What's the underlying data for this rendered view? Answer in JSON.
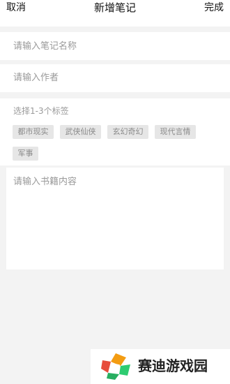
{
  "header": {
    "cancel_label": "取消",
    "title": "新增笔记",
    "done_label": "完成"
  },
  "form": {
    "note_name_placeholder": "请输入笔记名称",
    "author_placeholder": "请输入作者",
    "tags_label": "选择1-3个标签",
    "tags": [
      {
        "label": "都市现实"
      },
      {
        "label": "武侠仙侠"
      },
      {
        "label": "玄幻奇幻"
      },
      {
        "label": "现代言情"
      },
      {
        "label": "军事"
      }
    ],
    "content_placeholder": "请输入书籍内容"
  },
  "watermark": {
    "text": "赛迪游戏园",
    "logo_colors": [
      "#f39c12",
      "#e74c3c",
      "#2ecc71",
      "#27ae60"
    ]
  },
  "colors": {
    "background": "#f3f3f3",
    "surface": "#ffffff",
    "tag_bg": "#e6e6e6",
    "tag_text": "#8a8a8a",
    "placeholder": "#9a9a9a"
  }
}
